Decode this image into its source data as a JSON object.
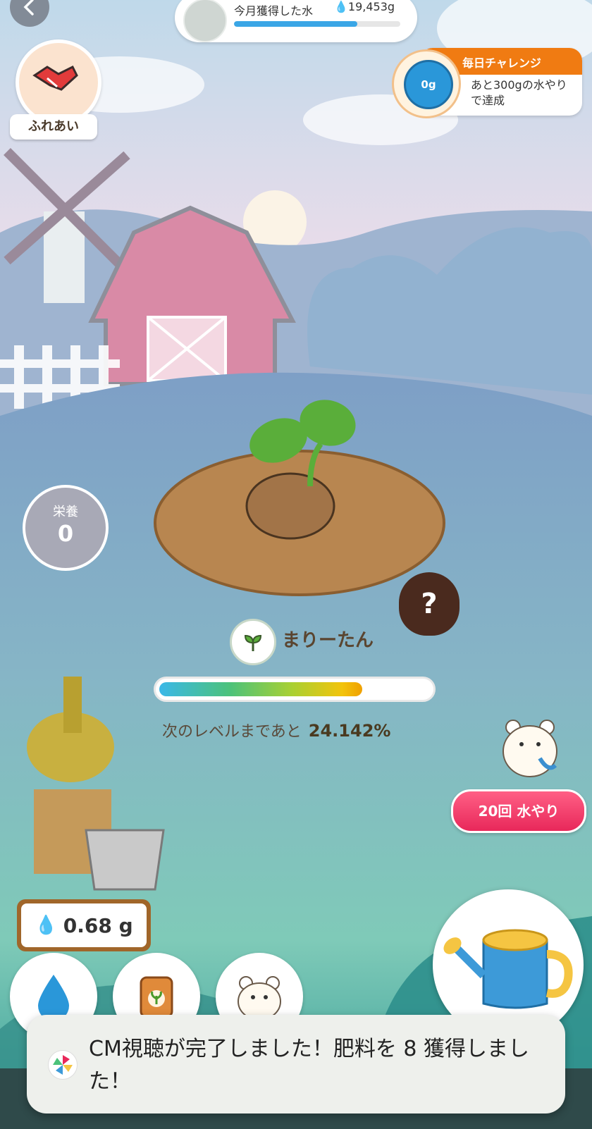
{
  "header": {
    "back_icon": "chevron-left-icon",
    "monthly_water_label": "今月獲得した水",
    "monthly_water_value": "19,453g",
    "monthly_water_progress": 0.74
  },
  "daily_challenge": {
    "title": "毎日チャレンジ",
    "jar_value": "0g",
    "text": "あと300gの水やりで達成"
  },
  "fureai": {
    "label": "ふれあい",
    "icon": "handshake-icon"
  },
  "nutrition": {
    "label": "栄養",
    "value": "0"
  },
  "plant": {
    "name": "まりーたん",
    "level_progress": 0.75,
    "level_text": "次のレベルまであと",
    "level_remaining": "24.142%"
  },
  "mystery": {
    "label": "?"
  },
  "water_action": {
    "label": "20回 水やり"
  },
  "water_amount": {
    "value": "0.68 g"
  },
  "tools": [
    "water-drop-icon",
    "fertilizer-bag-icon",
    "hamster-icon",
    "watering-can-icon"
  ],
  "toast": {
    "message": "CM視聴が完了しました！肥料を 8 獲得しました！"
  },
  "colors": {
    "accent_orange": "#f07b12",
    "accent_pink": "#e8285a",
    "water_blue": "#2a97d9"
  }
}
